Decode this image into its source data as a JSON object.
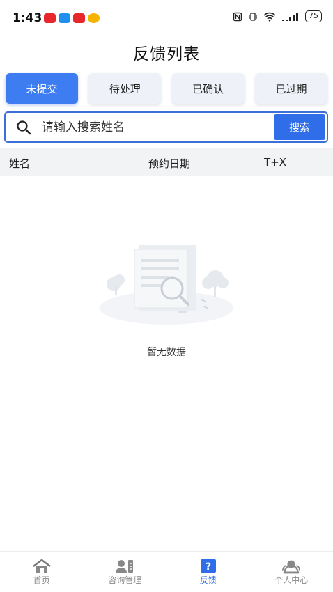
{
  "status_bar": {
    "time": "1:43",
    "battery": "75",
    "app_colors": [
      "#e8262d",
      "#1f8ff0",
      "#e8262d",
      "#f5b400"
    ]
  },
  "page": {
    "title": "反馈列表"
  },
  "tabs": [
    {
      "label": "未提交",
      "active": true
    },
    {
      "label": "待处理",
      "active": false
    },
    {
      "label": "已确认",
      "active": false
    },
    {
      "label": "已过期",
      "active": false
    }
  ],
  "search": {
    "placeholder": "请输入搜索姓名",
    "value": "",
    "button_label": "搜索"
  },
  "table": {
    "columns": [
      "姓名",
      "预约日期",
      "T+X"
    ]
  },
  "empty_state": {
    "text": "暂无数据"
  },
  "bottom_nav": [
    {
      "label": "首页",
      "icon": "home-icon",
      "active": false
    },
    {
      "label": "咨询管理",
      "icon": "consult-icon",
      "active": false
    },
    {
      "label": "反馈",
      "icon": "feedback-icon",
      "active": true
    },
    {
      "label": "个人中心",
      "icon": "user-icon",
      "active": false
    }
  ],
  "colors": {
    "accent": "#2f6ee8",
    "tab_active": "#3d7cf1",
    "nav_inactive": "#888888"
  }
}
